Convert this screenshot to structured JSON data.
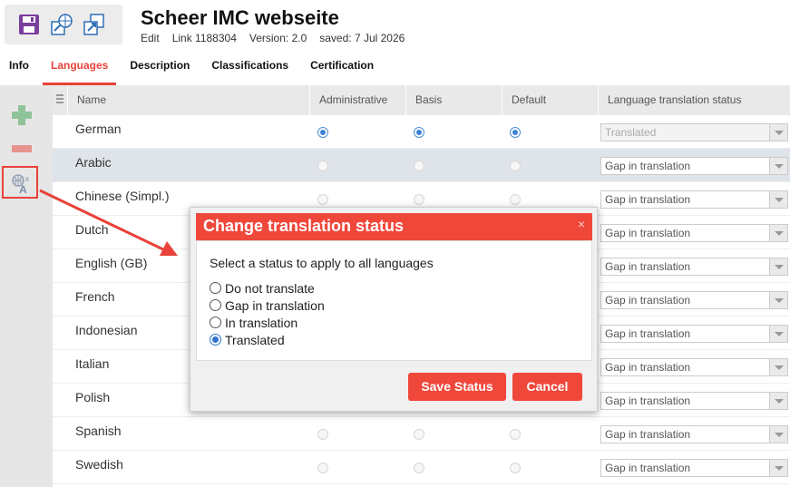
{
  "header": {
    "title": "Scheer IMC webseite",
    "meta": {
      "edit": "Edit",
      "link": "Link 1188304",
      "version": "Version: 2.0",
      "saved": "saved: 7 Jul 2026"
    }
  },
  "tabs": [
    {
      "label": "Info"
    },
    {
      "label": "Languages",
      "active": true
    },
    {
      "label": "Description"
    },
    {
      "label": "Classifications"
    },
    {
      "label": "Certification"
    }
  ],
  "grid": {
    "columns": {
      "name": "Name",
      "administrative": "Administrative",
      "basis": "Basis",
      "default": "Default",
      "status": "Language translation status"
    },
    "rows": [
      {
        "name": "German",
        "administrative": true,
        "basis": true,
        "default": true,
        "status": "Translated",
        "status_disabled": true
      },
      {
        "name": "Arabic",
        "administrative": false,
        "basis": false,
        "default": false,
        "status": "Gap in translation",
        "selected": true
      },
      {
        "name": "Chinese (Simpl.)",
        "administrative": false,
        "basis": false,
        "default": false,
        "status": "Gap in translation"
      },
      {
        "name": "Dutch",
        "administrative": false,
        "basis": false,
        "default": false,
        "status": "Gap in translation"
      },
      {
        "name": "English (GB)",
        "administrative": false,
        "basis": false,
        "default": false,
        "status": "Gap in translation"
      },
      {
        "name": "French",
        "administrative": false,
        "basis": false,
        "default": false,
        "status": "Gap in translation"
      },
      {
        "name": "Indonesian",
        "administrative": false,
        "basis": false,
        "default": false,
        "status": "Gap in translation"
      },
      {
        "name": "Italian",
        "administrative": false,
        "basis": false,
        "default": false,
        "status": "Gap in translation"
      },
      {
        "name": "Polish",
        "administrative": false,
        "basis": false,
        "default": false,
        "status": "Gap in translation"
      },
      {
        "name": "Spanish",
        "administrative": false,
        "basis": false,
        "default": false,
        "status": "Gap in translation"
      },
      {
        "name": "Swedish",
        "administrative": false,
        "basis": false,
        "default": false,
        "status": "Gap in translation"
      }
    ]
  },
  "modal": {
    "title": "Change translation status",
    "close": "×",
    "prompt": "Select a status to apply to all languages",
    "options": [
      {
        "label": "Do not translate",
        "checked": false
      },
      {
        "label": "Gap in translation",
        "checked": false
      },
      {
        "label": "In translation",
        "checked": false
      },
      {
        "label": "Translated",
        "checked": true
      }
    ],
    "save_label": "Save Status",
    "cancel_label": "Cancel"
  },
  "colors": {
    "accent": "#f0473b",
    "radio_selected": "#3c82d6",
    "rail_add": "#8fc39a",
    "rail_remove": "#e6948d"
  },
  "icons": {
    "toolbar": [
      "save-icon",
      "publish-web-icon",
      "export-icon"
    ],
    "rail": [
      "add-icon",
      "remove-icon",
      "translate-icon"
    ]
  }
}
